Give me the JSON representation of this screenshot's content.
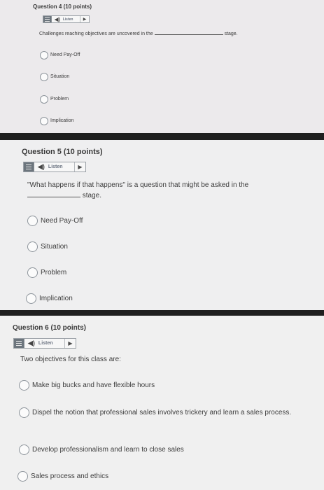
{
  "listen_label": "Listen",
  "q4": {
    "title": "Question 4 (10 points)",
    "prompt_before": "Challenges reaching objectives are uncovered in the",
    "prompt_after": "stage.",
    "options": [
      "Need Pay-Off",
      "Situation",
      "Problem",
      "Implication"
    ]
  },
  "q5": {
    "title": "Question 5 (10 points)",
    "prompt_before": "\"What happens if that happens\" is a question that might be asked in the",
    "prompt_after": "stage.",
    "options": [
      "Need Pay-Off",
      "Situation",
      "Problem",
      "Implication"
    ]
  },
  "q6": {
    "title": "Question 6 (10 points)",
    "prompt": "Two objectives for this class are:",
    "options": [
      "Make big bucks and have flexible hours",
      "Dispel the notion that professional sales involves trickery and learn a sales process.",
      "Develop professionalism and learn to close sales",
      "Sales process and ethics"
    ]
  }
}
